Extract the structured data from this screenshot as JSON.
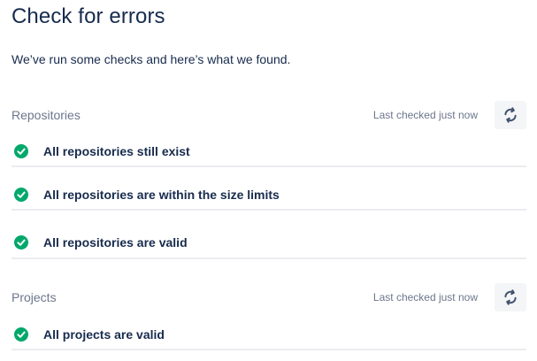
{
  "page": {
    "title": "Check for errors",
    "description": "We’ve run some checks and here’s what we found."
  },
  "sections": [
    {
      "title": "Repositories",
      "last_checked": "Last checked just now",
      "refresh_icon": "refresh-icon",
      "checks": [
        {
          "label": "All repositories still exist",
          "status": "success",
          "icon": "check-circle-icon"
        },
        {
          "label": "All repositories are within the size limits",
          "status": "success",
          "icon": "check-circle-icon"
        },
        {
          "label": "All repositories are valid",
          "status": "success",
          "icon": "check-circle-icon"
        }
      ]
    },
    {
      "title": "Projects",
      "last_checked": "Last checked just now",
      "refresh_icon": "refresh-icon",
      "checks": [
        {
          "label": "All projects are valid",
          "status": "success",
          "icon": "check-circle-icon"
        }
      ]
    }
  ],
  "colors": {
    "success": "#00a86b",
    "heading_text": "#172b4d",
    "muted_text": "#6b778c",
    "refresh_button_bg": "#f4f5f7",
    "divider": "#ebecf0",
    "refresh_icon": "#42526e"
  }
}
